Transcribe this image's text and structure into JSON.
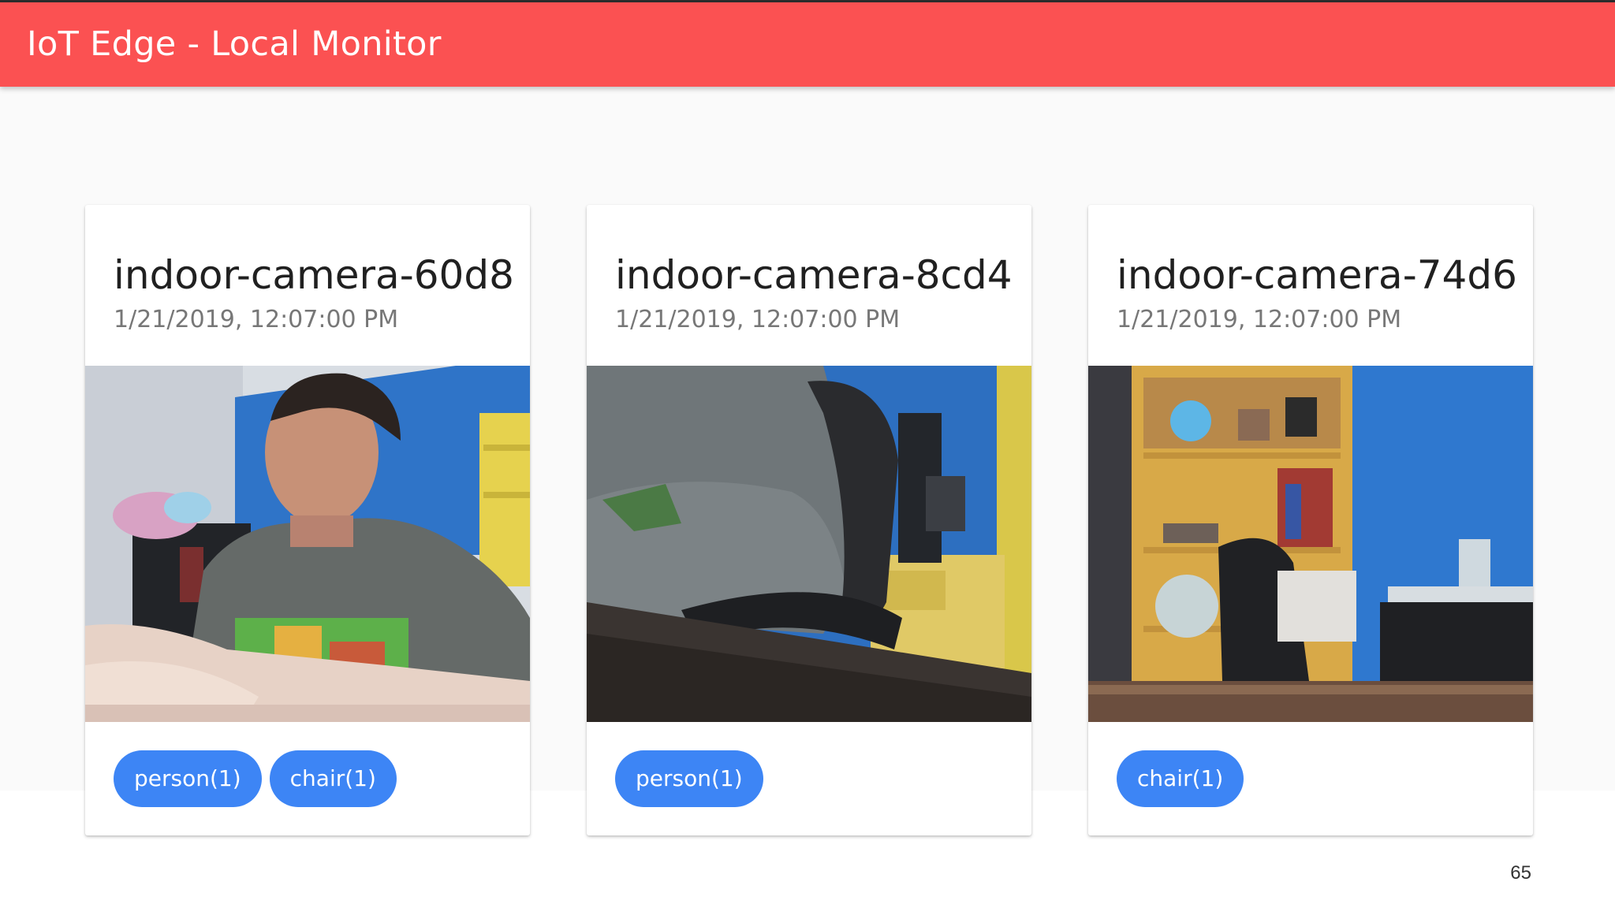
{
  "app": {
    "title": "IoT Edge - Local Monitor",
    "accent_color": "#fb5152",
    "chip_color": "#3d85f5"
  },
  "cameras": [
    {
      "name": "indoor-camera-60d8",
      "timestamp": "1/21/2019, 12:07:00 PM",
      "snapshot": "person seated at desk in front of blue wall with shelves",
      "detections": [
        "person(1)",
        "chair(1)"
      ]
    },
    {
      "name": "indoor-camera-8cd4",
      "timestamp": "1/21/2019, 12:07:00 PM",
      "snapshot": "person in grey t-shirt leaning in office chair beside desk",
      "detections": [
        "person(1)"
      ]
    },
    {
      "name": "indoor-camera-74d6",
      "timestamp": "1/21/2019, 12:07:00 PM",
      "snapshot": "empty office chair in front of yellow bookshelf and blue wall",
      "detections": [
        "chair(1)"
      ]
    }
  ],
  "slide_number": "65"
}
